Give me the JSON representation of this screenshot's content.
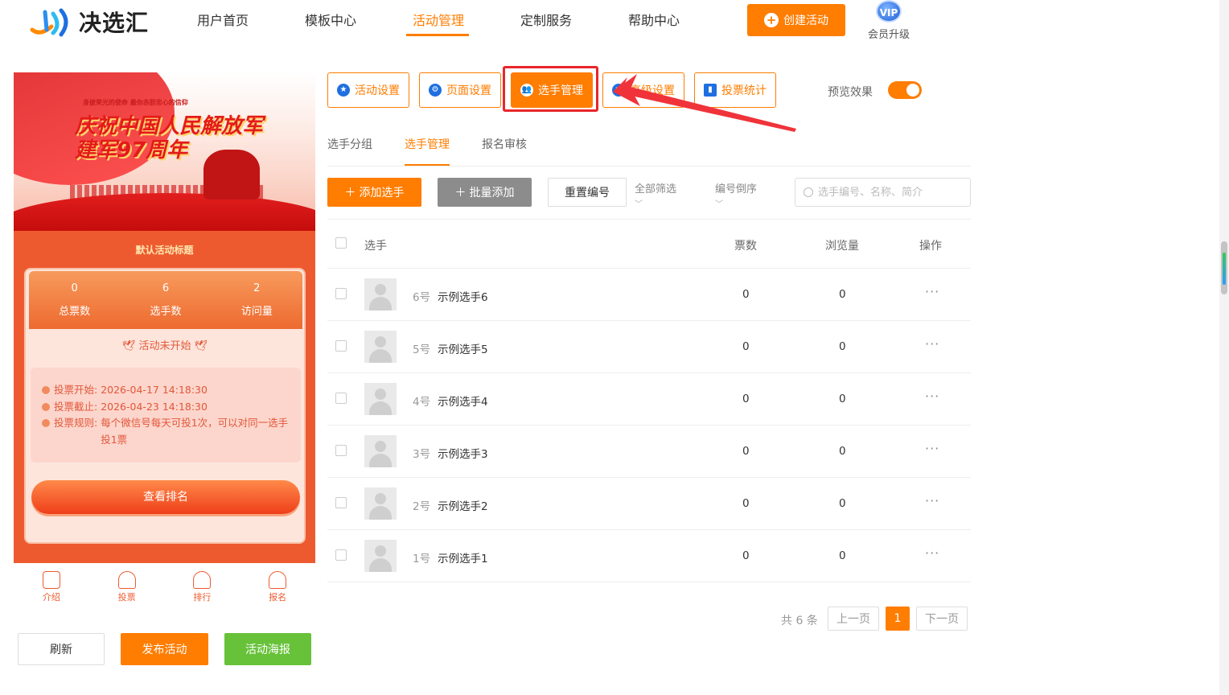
{
  "brand": {
    "name": "决选汇"
  },
  "nav": {
    "items": [
      "用户首页",
      "模板中心",
      "活动管理",
      "定制服务",
      "帮助中心"
    ],
    "active_index": 2,
    "create_label": "创建活动",
    "vip_badge": "VIP",
    "vip_label": "会员升级"
  },
  "preview": {
    "banner_title_line1": "庆祝中国人民解放军",
    "banner_title_line2": "建军97周年",
    "banner_slogan": "身披荣光的使命 最你赤胆忠心的信仰",
    "activity_title": "默认活动标题",
    "stats": [
      {
        "value": "0",
        "label": "总票数"
      },
      {
        "value": "6",
        "label": "选手数"
      },
      {
        "value": "2",
        "label": "访问量"
      }
    ],
    "status": "活动未开始",
    "info": [
      {
        "label": "投票开始:",
        "value": "2026-04-17 14:18:30"
      },
      {
        "label": "投票截止:",
        "value": "2026-04-23 14:18:30"
      },
      {
        "label": "投票规则:",
        "value": "每个微信号每天可投1次，可以对同一选手投1票"
      }
    ],
    "rank_button": "查看排名",
    "tabbar": [
      "介绍",
      "投票",
      "排行",
      "报名"
    ]
  },
  "preview_actions": {
    "refresh": "刷新",
    "publish": "发布活动",
    "poster": "活动海报"
  },
  "settings_tabs": [
    "活动设置",
    "页面设置",
    "选手管理",
    "高级设置",
    "投票统计"
  ],
  "settings_active_index": 2,
  "preview_toggle": {
    "label": "预览效果",
    "on": true
  },
  "sub_tabs": [
    "选手分组",
    "选手管理",
    "报名审核"
  ],
  "sub_active_index": 1,
  "toolbar": {
    "add": "添加选手",
    "batch_add": "批量添加",
    "reset_number": "重置编号",
    "filter_all": "全部筛选",
    "sort_desc": "编号倒序",
    "search_placeholder": "选手编号、名称、简介"
  },
  "table": {
    "headers": {
      "player": "选手",
      "votes": "票数",
      "views": "浏览量",
      "ops": "操作"
    },
    "rows": [
      {
        "num": "6号",
        "name": "示例选手6",
        "votes": "0",
        "views": "0"
      },
      {
        "num": "5号",
        "name": "示例选手5",
        "votes": "0",
        "views": "0"
      },
      {
        "num": "4号",
        "name": "示例选手4",
        "votes": "0",
        "views": "0"
      },
      {
        "num": "3号",
        "name": "示例选手3",
        "votes": "0",
        "views": "0"
      },
      {
        "num": "2号",
        "name": "示例选手2",
        "votes": "0",
        "views": "0"
      },
      {
        "num": "1号",
        "name": "示例选手1",
        "votes": "0",
        "views": "0"
      }
    ],
    "more_icon": "···"
  },
  "pagination": {
    "total": "共 6 条",
    "prev": "上一页",
    "current": "1",
    "next": "下一页"
  },
  "colors": {
    "accent": "#ff7d00",
    "highlight": "#e8262b",
    "green": "#67c23a",
    "gray": "#8c8c8c"
  }
}
